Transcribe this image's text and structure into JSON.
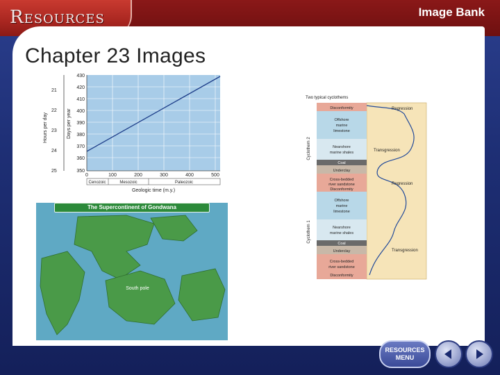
{
  "header": {
    "resources_label": "Resources",
    "bank_title": "Image Bank"
  },
  "main": {
    "chapter_title": "Chapter 23 Images"
  },
  "figure_hours": {
    "left_ticks": [
      "21",
      "22",
      "23",
      "24",
      "25"
    ],
    "left_axis_label": "Hours per day",
    "right_ticks": [
      "430",
      "420",
      "410",
      "400",
      "390",
      "380",
      "370",
      "360",
      "350"
    ],
    "right_axis_label": "Days per year",
    "x_ticks": [
      "0",
      "100",
      "200",
      "300",
      "400",
      "500"
    ],
    "eras": [
      "Cenozoic",
      "Mesozoic",
      "Paleozoic"
    ],
    "x_label": "Geologic time (m.y.)"
  },
  "figure_gondwana": {
    "title": "The Supercontinent of Gondwana",
    "pole_label": "South pole",
    "colors": {
      "ocean": "#5fa9c4",
      "land": "#4a9a48",
      "banner": "#2c8a3a"
    }
  },
  "figure_cyclothems": {
    "title": "Two typical cyclothems",
    "group_labels": [
      "Cyclothem 2",
      "Cyclothem 1"
    ],
    "layers": [
      "Disconformity",
      "Offshore",
      "marine",
      "limestone",
      "Nearshore",
      "marine shales",
      "Coal",
      "Underclay",
      "Cross-bedded",
      "river sandstone",
      "Disconformity",
      "Offshore",
      "marine",
      "limestone",
      "Nearshore",
      "marine shales",
      "Coal",
      "Underclay",
      "Cross-bedded",
      "river sandstone",
      "Disconformity"
    ],
    "curve_labels": [
      "Regression",
      "Transgression",
      "Regression",
      "Transgression"
    ]
  },
  "nav": {
    "menu_label_1": "RESOURCES",
    "menu_label_2": "MENU",
    "prev_icon": "triangle-left",
    "next_icon": "triangle-right"
  }
}
